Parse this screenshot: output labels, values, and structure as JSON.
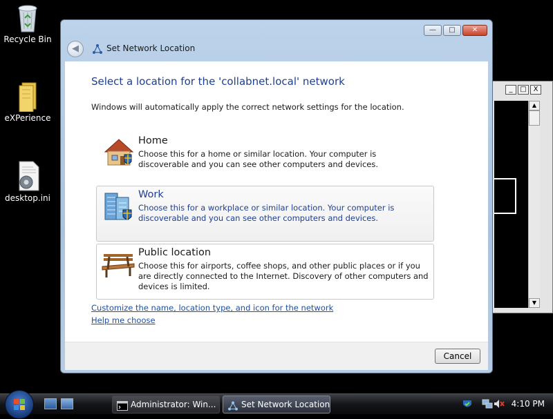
{
  "desktop": {
    "icons": [
      {
        "label": "Recycle Bin",
        "icon": "recycle-bin-icon"
      },
      {
        "label": "eXPerience",
        "icon": "folder-icon"
      },
      {
        "label": "desktop.ini",
        "icon": "settings-file-icon"
      }
    ]
  },
  "console_window": {
    "minimize": "_",
    "maximize": "□",
    "close": "X",
    "scroll_up": "▲",
    "scroll_down": "▼"
  },
  "dialog": {
    "title": "Set Network Location",
    "heading": "Select a location for the 'collabnet.local' network",
    "intro": "Windows will automatically apply the correct network settings for the location.",
    "options": [
      {
        "title": "Home",
        "description": "Choose this for a home or similar location. Your computer is discoverable and you can see other computers and devices.",
        "icon": "home-icon"
      },
      {
        "title": "Work",
        "description": "Choose this for a workplace or similar location. Your computer is discoverable and you can see other computers and devices.",
        "icon": "office-building-icon"
      },
      {
        "title": "Public location",
        "description": "Choose this for airports, coffee shops, and other public places or if you are directly connected to the Internet. Discovery of other computers and devices is limited.",
        "icon": "park-bench-icon"
      }
    ],
    "links": [
      "Customize the name, location type, and icon for the network",
      "Help me choose"
    ],
    "cancel_label": "Cancel",
    "window_buttons": {
      "minimize": "—",
      "maximize": "□",
      "close": "✕"
    }
  },
  "taskbar": {
    "tasks": [
      {
        "label": "Administrator:  Win...",
        "icon": "command-prompt-icon",
        "active": false
      },
      {
        "label": "Set Network Location",
        "icon": "network-icon",
        "active": true
      }
    ],
    "clock": "4:10 PM"
  },
  "colors": {
    "heading_blue": "#1e3e8f",
    "link_blue": "#1e4fa0",
    "desktop_bg": "#000000"
  }
}
